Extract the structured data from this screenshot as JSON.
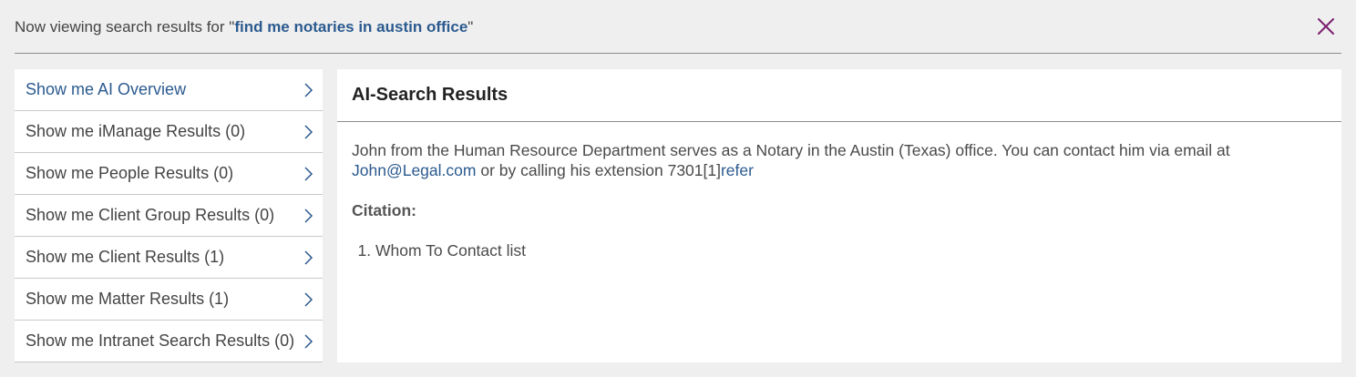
{
  "header": {
    "prefix": "Now viewing search results for ",
    "quote_open": "\"",
    "query": "find me notaries in austin office",
    "quote_close": "\"",
    "close_icon": "close-icon"
  },
  "sidebar": {
    "items": [
      {
        "label": "Show me AI Overview",
        "active": true
      },
      {
        "label": "Show me iManage Results (0)"
      },
      {
        "label": "Show me People Results (0)"
      },
      {
        "label": "Show me Client Group Results (0)"
      },
      {
        "label": "Show me Client Results (1)"
      },
      {
        "label": "Show me Matter Results (1)"
      },
      {
        "label": "Show me Intranet Search Results (0)"
      }
    ]
  },
  "main": {
    "title": "AI-Search Results",
    "answer_text": "John from the Human Resource Department serves as a Notary in the Austin (Texas) office. You can contact him via email at ",
    "email": "John@Legal.com",
    "answer_text_2": " or by calling his extension 7301[1]",
    "refer_link": "refer",
    "citation_heading": "Citation:",
    "citations": [
      "Whom To Contact list"
    ]
  },
  "colors": {
    "accent": "#2b5a8f",
    "close": "#7a1f6f"
  }
}
